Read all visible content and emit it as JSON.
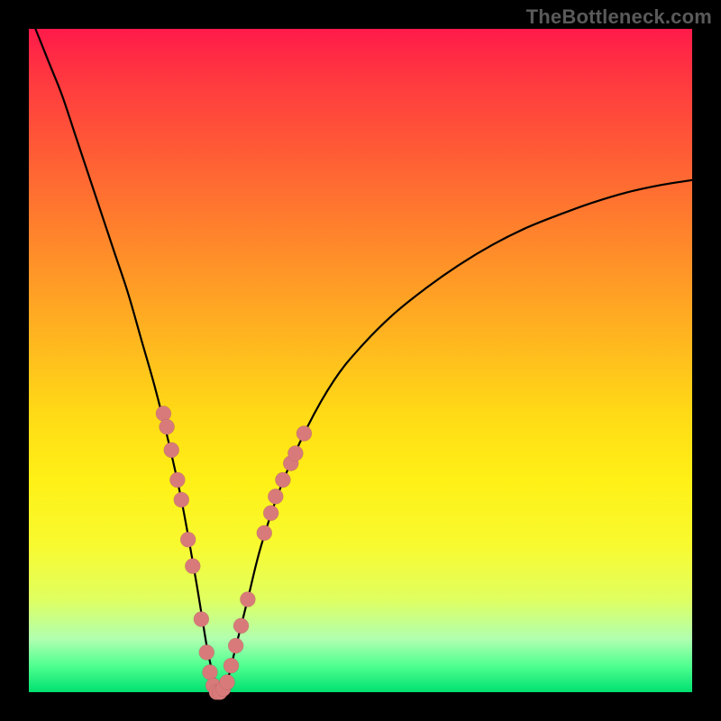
{
  "watermark": "TheBottleneck.com",
  "chart_data": {
    "type": "line",
    "title": "",
    "xlabel": "",
    "ylabel": "",
    "xlim": [
      0,
      100
    ],
    "ylim": [
      0,
      100
    ],
    "grid": false,
    "legend": false,
    "series": [
      {
        "name": "bottleneck-curve",
        "x": [
          1,
          3,
          5,
          7,
          9,
          11,
          13,
          15,
          17,
          19,
          21,
          23,
          25,
          26,
          27,
          28,
          29,
          30,
          31,
          33,
          35,
          38,
          42,
          46,
          50,
          55,
          60,
          65,
          70,
          75,
          80,
          85,
          90,
          95,
          100
        ],
        "y": [
          100,
          95,
          90,
          84,
          78,
          72,
          66,
          60,
          53,
          46,
          38,
          29,
          18,
          12,
          6,
          2,
          0,
          2,
          6,
          14,
          22,
          31,
          40,
          47,
          52,
          57,
          61,
          64.5,
          67.5,
          70,
          72,
          73.8,
          75.3,
          76.4,
          77.2
        ]
      }
    ],
    "markers": [
      {
        "x": 20.3,
        "y": 42
      },
      {
        "x": 20.8,
        "y": 40
      },
      {
        "x": 21.5,
        "y": 36.5
      },
      {
        "x": 22.4,
        "y": 32
      },
      {
        "x": 23.0,
        "y": 29
      },
      {
        "x": 24.0,
        "y": 23
      },
      {
        "x": 24.7,
        "y": 19
      },
      {
        "x": 26.0,
        "y": 11
      },
      {
        "x": 26.8,
        "y": 6
      },
      {
        "x": 27.3,
        "y": 3
      },
      {
        "x": 27.8,
        "y": 1
      },
      {
        "x": 28.3,
        "y": 0
      },
      {
        "x": 28.8,
        "y": 0
      },
      {
        "x": 29.3,
        "y": 0.5
      },
      {
        "x": 29.9,
        "y": 1.5
      },
      {
        "x": 30.5,
        "y": 4
      },
      {
        "x": 31.2,
        "y": 7
      },
      {
        "x": 32.0,
        "y": 10
      },
      {
        "x": 33.0,
        "y": 14
      },
      {
        "x": 35.5,
        "y": 24
      },
      {
        "x": 36.5,
        "y": 27
      },
      {
        "x": 37.2,
        "y": 29.5
      },
      {
        "x": 38.3,
        "y": 32
      },
      {
        "x": 39.5,
        "y": 34.5
      },
      {
        "x": 40.2,
        "y": 36
      },
      {
        "x": 41.5,
        "y": 39
      }
    ],
    "marker_radius_px": 8.5
  }
}
